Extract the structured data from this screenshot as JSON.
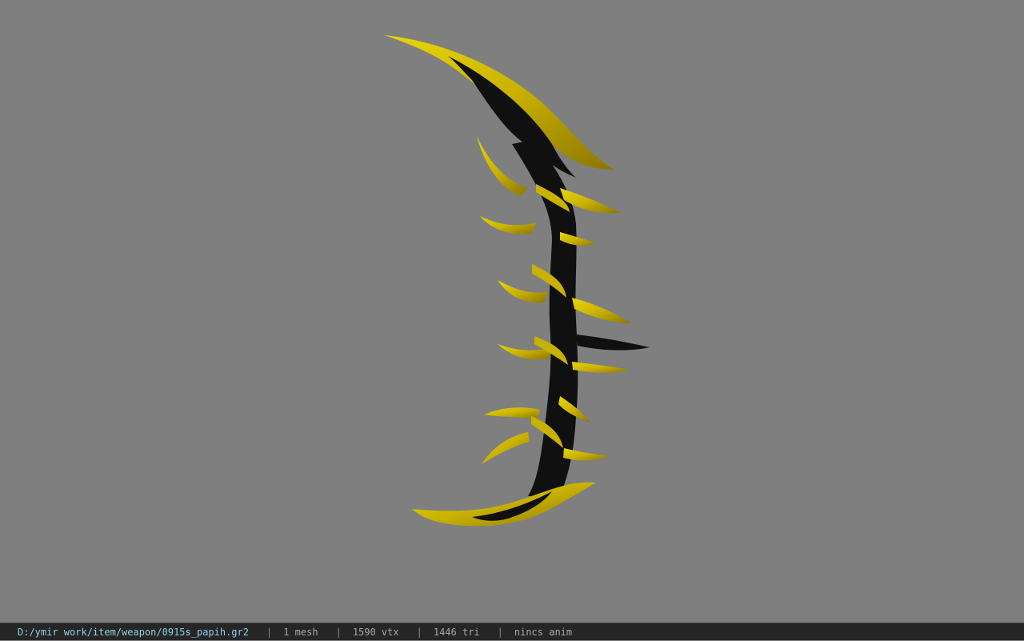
{
  "viewport": {
    "background": "#7f7f7f",
    "model_colors": {
      "gold": "#d8c000",
      "gold_dark": "#8f7d00",
      "black": "#101010"
    }
  },
  "statusbar": {
    "path": "D:/ymir work/item/weapon/0915s_papih.gr2",
    "separator": "|",
    "mesh_count": "1 mesh",
    "vertex_count": "1590 vtx",
    "triangle_count": "1446 tri",
    "anim_status": "nincs anim"
  }
}
